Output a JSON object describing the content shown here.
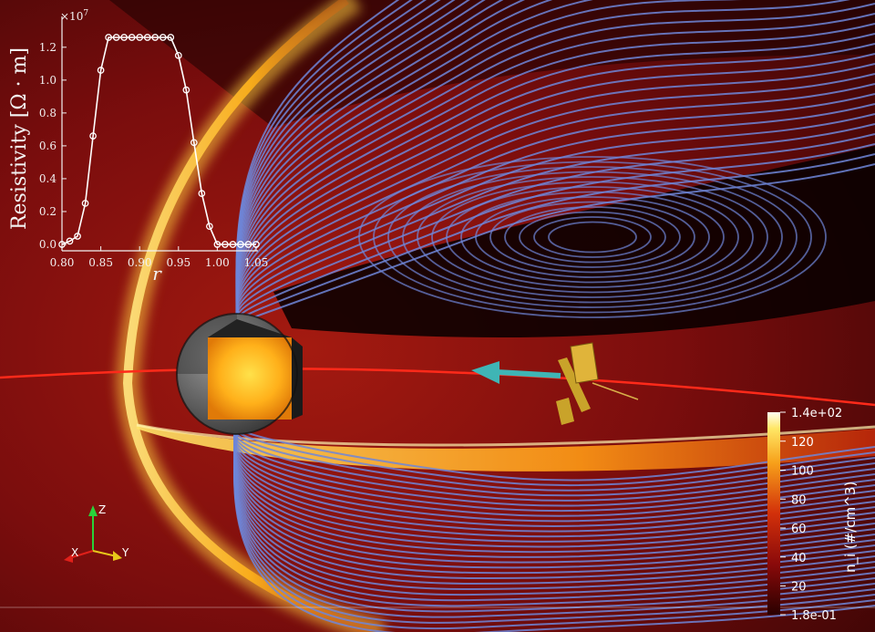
{
  "chart_data": [
    {
      "type": "line",
      "title": "",
      "xlabel": "r",
      "ylabel": "Resistivity [Ω · m]",
      "y_multiplier_label": "×10",
      "y_multiplier_exponent": "7",
      "xlim": [
        0.8,
        1.05
      ],
      "ylim": [
        0,
        1.26
      ],
      "x_ticks": [
        0.8,
        0.85,
        0.9,
        0.95,
        1.0,
        1.05
      ],
      "x_tick_labels": [
        "0.80",
        "0.85",
        "0.90",
        "0.95",
        "1.00",
        "1.05"
      ],
      "y_ticks": [
        0.0,
        0.2,
        0.4,
        0.6,
        0.8,
        1.0,
        1.2
      ],
      "y_tick_labels": [
        "0.0",
        "0.2",
        "0.4",
        "0.6",
        "0.8",
        "1.0",
        "1.2"
      ],
      "grid": false,
      "markers": "open-circle",
      "series": [
        {
          "x": [
            0.8,
            0.81,
            0.82,
            0.83,
            0.84,
            0.85,
            0.86,
            0.87,
            0.88,
            0.89,
            0.9,
            0.91,
            0.92,
            0.93,
            0.94,
            0.95,
            0.96,
            0.97,
            0.98,
            0.99,
            1.0,
            1.01,
            1.02,
            1.03,
            1.04,
            1.05
          ],
          "values": [
            0.0,
            0.02,
            0.05,
            0.25,
            0.66,
            1.06,
            1.26,
            1.26,
            1.26,
            1.26,
            1.26,
            1.26,
            1.26,
            1.26,
            1.26,
            1.15,
            0.94,
            0.62,
            0.31,
            0.11,
            0.0,
            0.0,
            0.0,
            0.0,
            0.0,
            0.0
          ]
        }
      ]
    },
    {
      "type": "heatmap",
      "colorbar_label": "n_i (#/cm^3)",
      "colorbar_ticks": [
        "1.4e+02",
        "120",
        "100",
        "80",
        "60",
        "40",
        "20",
        "1.8e-01"
      ],
      "colorbar_tick_values": [
        140,
        120,
        100,
        80,
        60,
        40,
        20,
        0.18
      ],
      "colorbar_range": [
        0.18,
        140
      ]
    }
  ],
  "axes_triad": {
    "x": "X",
    "y": "Y",
    "z": "Z"
  },
  "colors": {
    "field_lines": "#6f86d8",
    "orbit": "#ff2a1a",
    "arrow": "#3fb5b5",
    "background": "#7a0d0d",
    "bow_shock": "#ffd23f"
  }
}
